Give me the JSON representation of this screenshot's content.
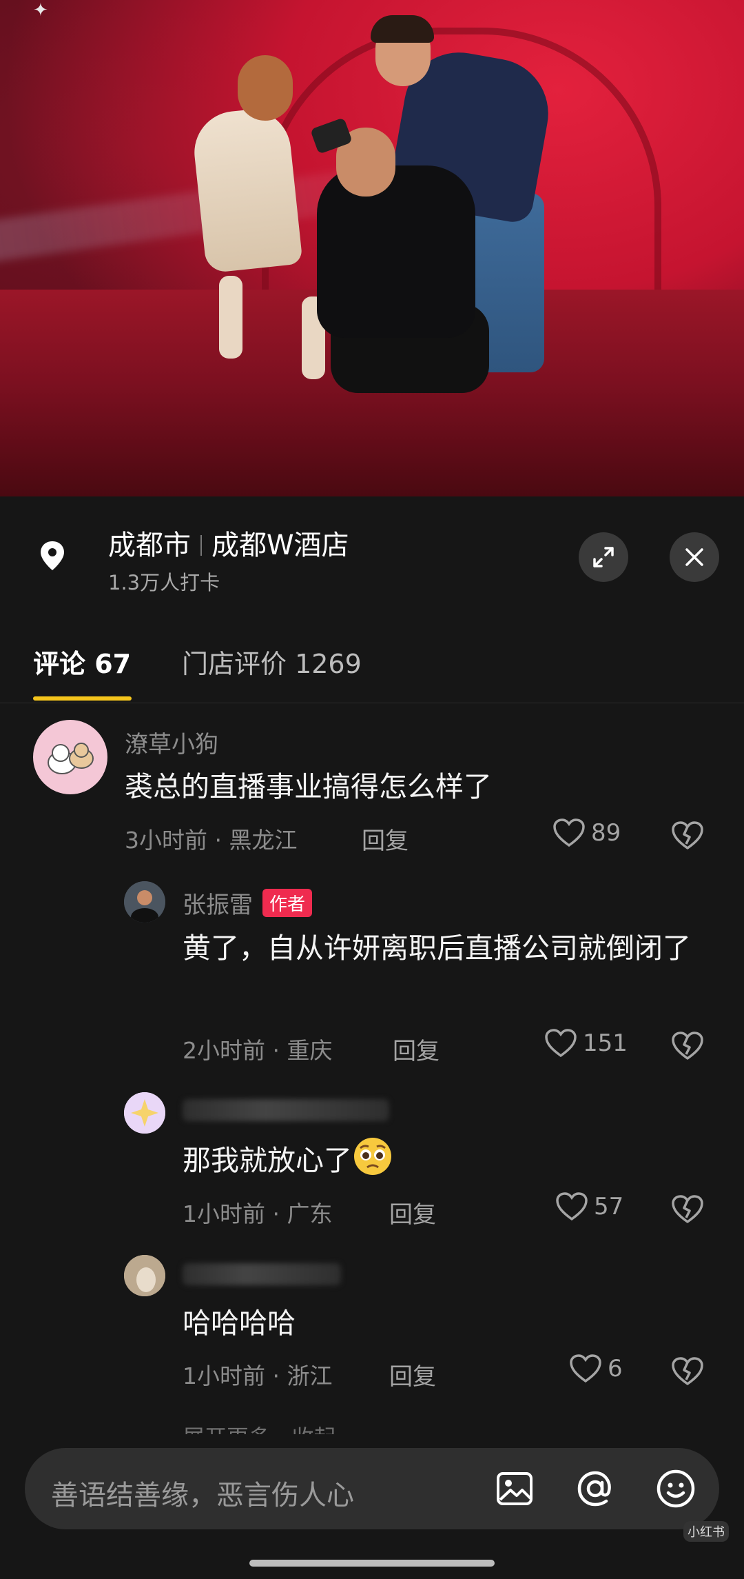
{
  "location": {
    "city": "成都市",
    "place": "成都W酒店",
    "checkins": "1.3万人打卡"
  },
  "tabs": [
    {
      "label": "评论 67",
      "active": true
    },
    {
      "label": "门店评价 1269",
      "active": false
    }
  ],
  "comments": [
    {
      "username": "潦草小狗",
      "text": "裘总的直播事业搞得怎么样了",
      "time_region": "3小时前 · 黑龙江",
      "reply_label": "回复",
      "likes": "89",
      "avatar_icon": "cartoon-dogs-avatar"
    },
    {
      "username": "张振雷",
      "badge": "作者",
      "text": "黄了，自从许妍离职后直播公司就倒闭了",
      "time_region": "2小时前 · 重庆",
      "reply_label": "回复",
      "likes": "151",
      "avatar_icon": "man-photo-avatar"
    },
    {
      "username": "",
      "text": "那我就放心了",
      "emoji": "pleading-face-emoji",
      "time_region": "1小时前 · 广东",
      "reply_label": "回复",
      "likes": "57",
      "avatar_icon": "sparkle-avatar"
    },
    {
      "username": "",
      "text": "哈哈哈哈",
      "time_region": "1小时前 · 浙江",
      "reply_label": "回复",
      "likes": "6",
      "avatar_icon": "photo-avatar"
    }
  ],
  "more_hint": "展开更多 · 收起",
  "input": {
    "placeholder": "善语结善缘，恶言伤人心"
  },
  "watermark": "小红书",
  "colors": {
    "accent_tab": "#f5c51c",
    "author_badge": "#ef2b4f",
    "background": "#161616"
  }
}
